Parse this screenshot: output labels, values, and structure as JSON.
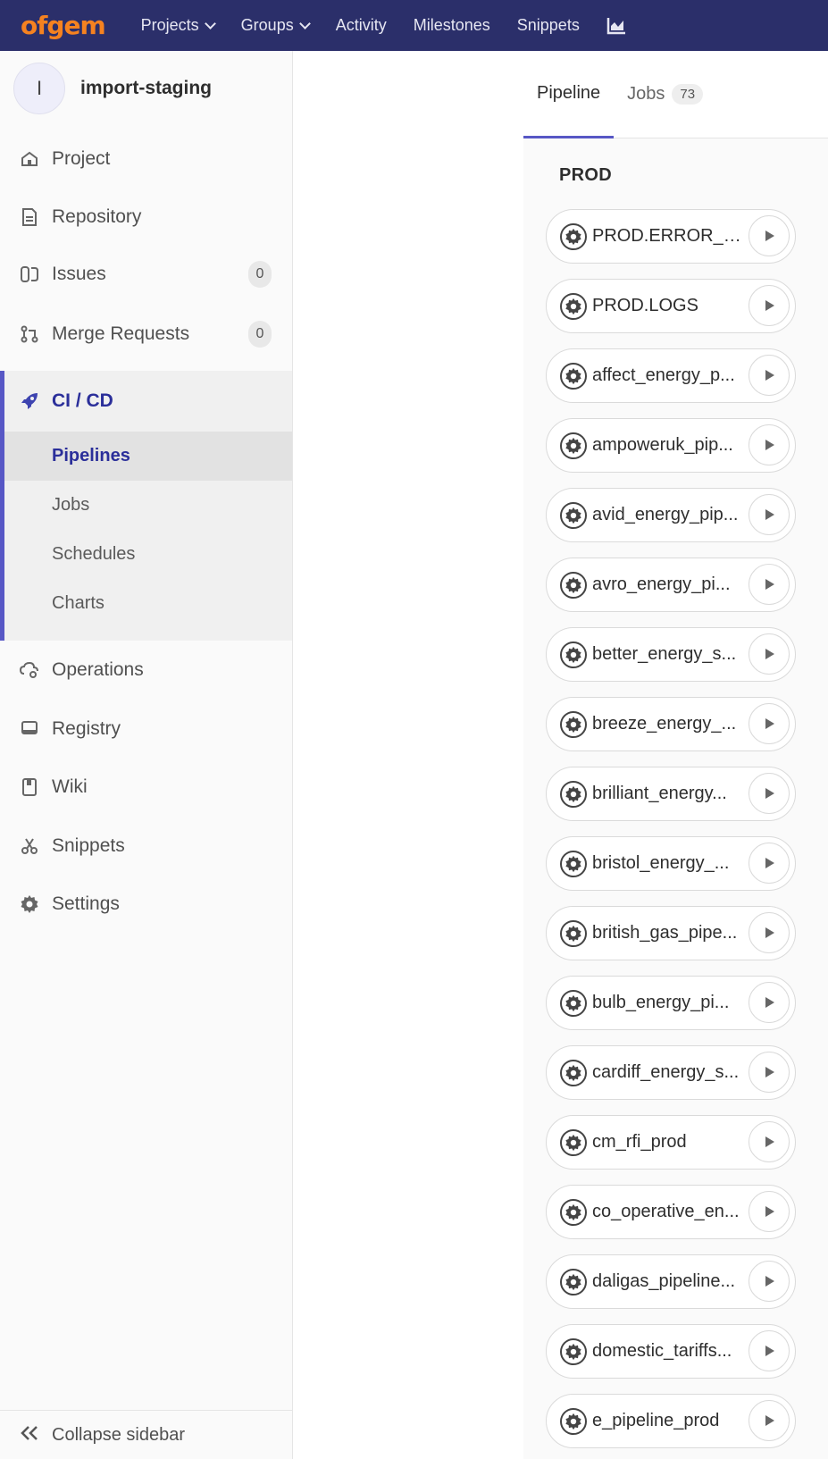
{
  "navbar": {
    "logo": "ofgem",
    "items": [
      "Projects",
      "Groups",
      "Activity",
      "Milestones",
      "Snippets"
    ],
    "chart_icon": "chart-icon"
  },
  "sidebar": {
    "avatar_letter": "I",
    "project_name": "import-staging",
    "items": [
      {
        "label": "Project",
        "icon": "home-icon"
      },
      {
        "label": "Repository",
        "icon": "doc-icon"
      },
      {
        "label": "Issues",
        "icon": "issues-icon",
        "badge": "0"
      },
      {
        "label": "Merge Requests",
        "icon": "merge-icon",
        "badge": "0"
      }
    ],
    "cicd": {
      "label": "CI / CD",
      "sub": [
        "Pipelines",
        "Jobs",
        "Schedules",
        "Charts"
      ],
      "active": "Pipelines"
    },
    "items_after": [
      {
        "label": "Operations",
        "icon": "cloud-icon"
      },
      {
        "label": "Registry",
        "icon": "registry-icon"
      },
      {
        "label": "Wiki",
        "icon": "book-icon"
      },
      {
        "label": "Snippets",
        "icon": "scissors-icon"
      },
      {
        "label": "Settings",
        "icon": "gear-icon"
      }
    ],
    "collapse_label": "Collapse sidebar"
  },
  "tabs": {
    "pipeline": "Pipeline",
    "jobs": "Jobs",
    "jobs_count": "73"
  },
  "stage": {
    "title": "PROD",
    "jobs": [
      "PROD.ERROR_L...",
      "PROD.LOGS",
      "affect_energy_p...",
      "ampoweruk_pip...",
      "avid_energy_pip...",
      "avro_energy_pi...",
      "better_energy_s...",
      "breeze_energy_...",
      "brilliant_energy...",
      "bristol_energy_...",
      "british_gas_pipe...",
      "bulb_energy_pi...",
      "cardiff_energy_s...",
      "cm_rfi_prod",
      "co_operative_en...",
      "daligas_pipeline...",
      "domestic_tariffs...",
      "e_pipeline_prod"
    ]
  }
}
